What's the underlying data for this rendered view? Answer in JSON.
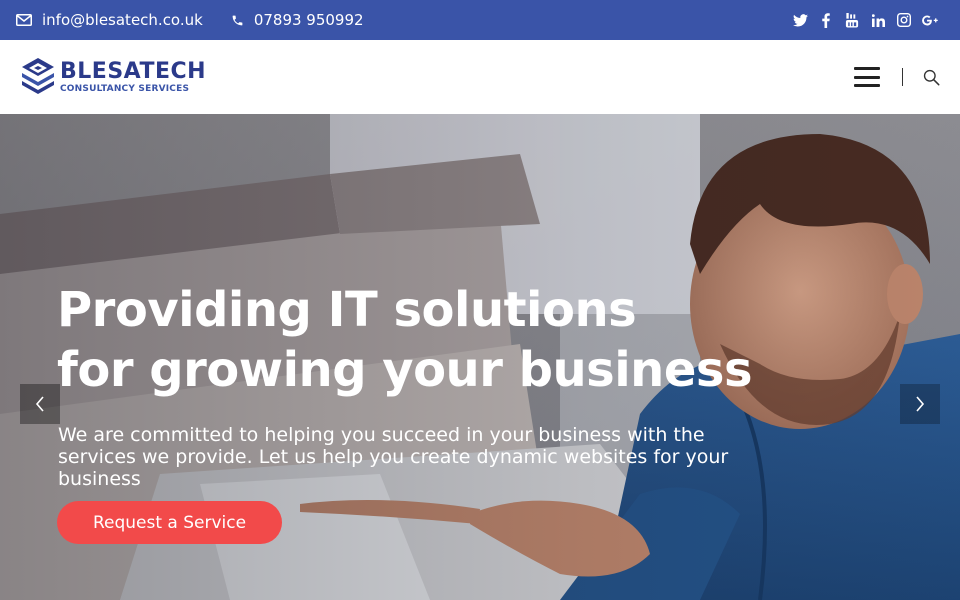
{
  "topbar": {
    "email": "info@blesatech.co.uk",
    "phone": "07893 950992",
    "social": [
      "twitter",
      "facebook",
      "youtube",
      "linkedin",
      "instagram",
      "google-plus"
    ],
    "bg_color": "#3a54a8"
  },
  "header": {
    "logo_name": "BLESATECH",
    "logo_tagline": "CONSULTANCY SERVICES"
  },
  "hero": {
    "title_line1": "Providing IT solutions",
    "title_line2": "for growing your business",
    "subtitle": "We are committed to helping you succeed in your business with the services we provide. Let us help you create dynamic websites for your business",
    "cta_label": "Request a Service",
    "cta_color": "#f24a4a"
  },
  "icons": {
    "envelope": "envelope-icon",
    "phone": "phone-icon",
    "menu": "hamburger-menu-icon",
    "search": "search-icon",
    "prev": "chevron-left-icon",
    "next": "chevron-right-icon"
  }
}
